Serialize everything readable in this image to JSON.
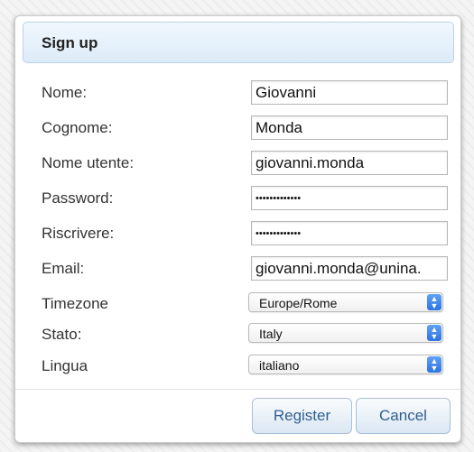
{
  "dialog": {
    "title": "Sign up"
  },
  "form": {
    "nome": {
      "label": "Nome:",
      "value": "Giovanni"
    },
    "cognome": {
      "label": "Cognome:",
      "value": "Monda"
    },
    "nome_utente": {
      "label": "Nome utente:",
      "value": "giovanni.monda"
    },
    "password": {
      "label": "Password:",
      "value": "•••••••••••••"
    },
    "riscrivere": {
      "label": "Riscrivere:",
      "value": "•••••••••••••"
    },
    "email": {
      "label": "Email:",
      "value": "giovanni.monda@unina."
    },
    "timezone": {
      "label": "Timezone",
      "selected": "Europe/Rome"
    },
    "stato": {
      "label": "Stato:",
      "selected": "Italy"
    },
    "lingua": {
      "label": "Lingua",
      "selected": "italiano"
    }
  },
  "buttons": {
    "register": "Register",
    "cancel": "Cancel"
  },
  "icons": {
    "select_arrow": "up-down-chevron-icon"
  },
  "colors": {
    "header_bg": "#dcebf8",
    "button_text": "#2f5f8f",
    "select_arrow_bg": "#2d73e3"
  }
}
